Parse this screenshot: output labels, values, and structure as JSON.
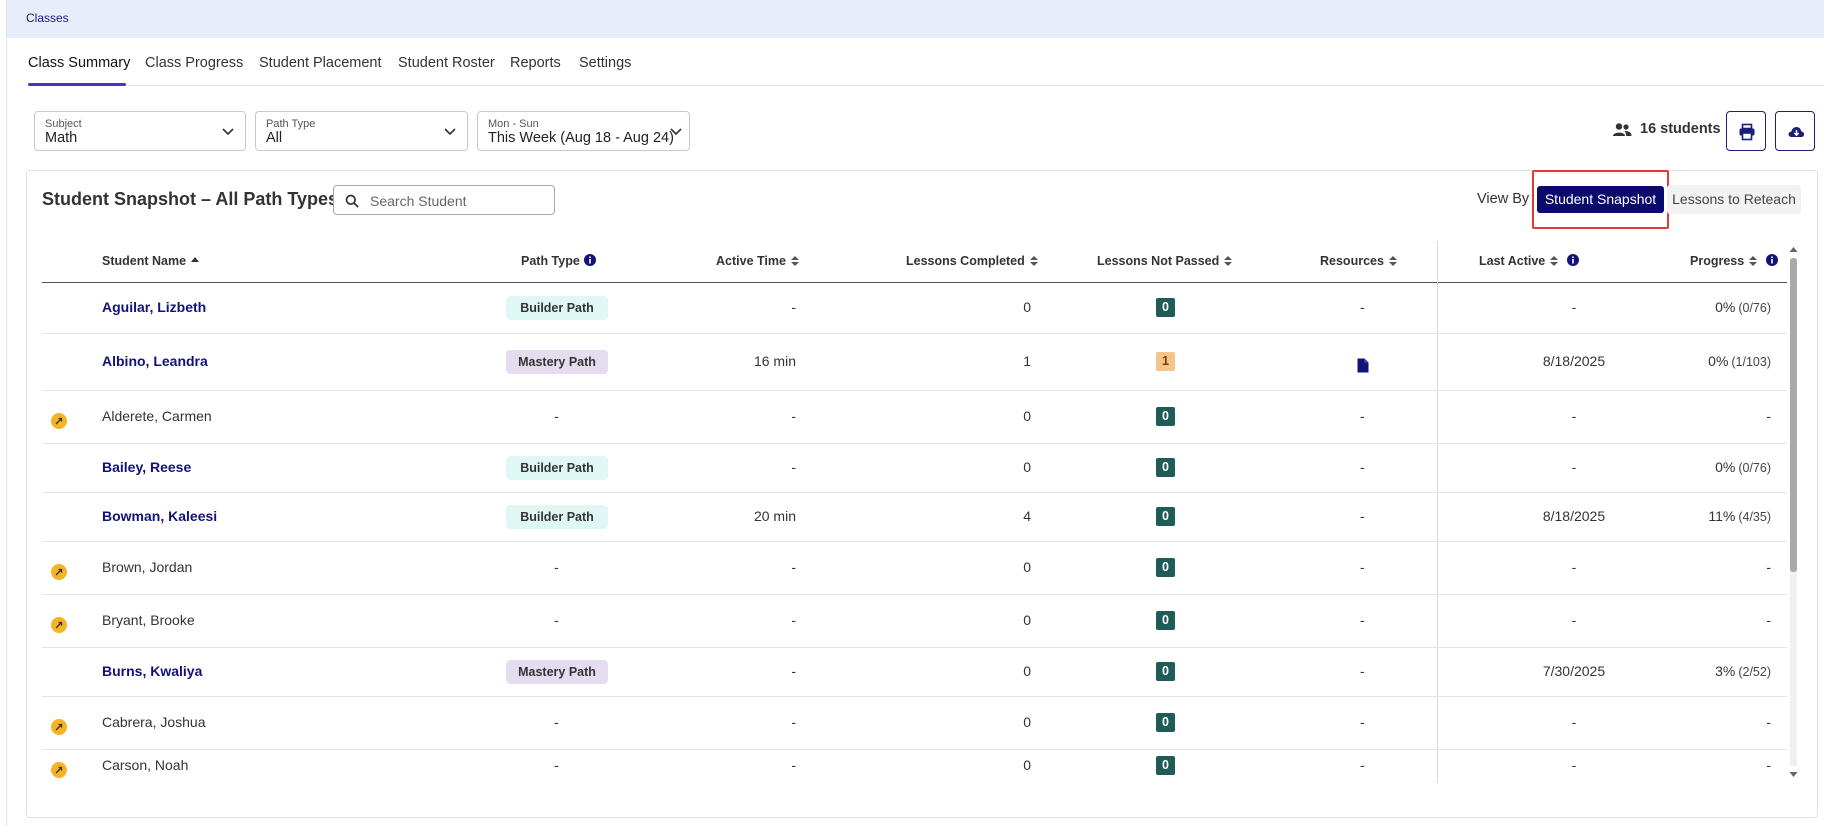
{
  "breadcrumb": "Classes",
  "tabs": [
    "Class Summary",
    "Class Progress",
    "Student Placement",
    "Student Roster",
    "Reports",
    "Settings"
  ],
  "active_tab": "Class Summary",
  "filters": {
    "subject": {
      "label": "Subject",
      "value": "Math"
    },
    "path_type": {
      "label": "Path Type",
      "value": "All"
    },
    "date_range": {
      "label": "Mon - Sun",
      "value": "This Week (Aug 18 - Aug 24)"
    }
  },
  "students_count": "16 students",
  "toolbar": {
    "print_icon": "print-icon",
    "download_icon": "cloud-download-icon"
  },
  "snapshot": {
    "title": "Student Snapshot – All Path Types",
    "search_placeholder": "Search Student",
    "view_by_label": "View By",
    "view_options": [
      "Student Snapshot",
      "Lessons to Reteach"
    ],
    "selected_view": "Student Snapshot"
  },
  "table": {
    "headers": {
      "student_name": "Student Name",
      "path_type": "Path Type",
      "active_time": "Active Time",
      "lessons_completed": "Lessons Completed",
      "lessons_not_passed": "Lessons Not Passed",
      "resources": "Resources",
      "last_active": "Last Active",
      "progress": "Progress"
    },
    "rows": [
      {
        "status_icon": false,
        "name": "Aguilar, Lizbeth",
        "linked": true,
        "path_type": "Builder Path",
        "active_time": "-",
        "lessons_completed": "0",
        "lessons_not_passed": "0",
        "not_passed_warn": false,
        "resources": "-",
        "last_active": "-",
        "progress_pct": "0%",
        "progress_count": "(0/76)"
      },
      {
        "status_icon": false,
        "name": "Albino, Leandra",
        "linked": true,
        "path_type": "Mastery Path",
        "active_time": "16 min",
        "lessons_completed": "1",
        "lessons_not_passed": "1",
        "not_passed_warn": true,
        "resources": "document-icon",
        "last_active": "8/18/2025",
        "progress_pct": "0%",
        "progress_count": "(1/103)"
      },
      {
        "status_icon": true,
        "name": "Alderete, Carmen",
        "linked": false,
        "path_type": "-",
        "active_time": "-",
        "lessons_completed": "0",
        "lessons_not_passed": "0",
        "not_passed_warn": false,
        "resources": "-",
        "last_active": "-",
        "progress_pct": "-",
        "progress_count": ""
      },
      {
        "status_icon": false,
        "name": "Bailey, Reese",
        "linked": true,
        "path_type": "Builder Path",
        "active_time": "-",
        "lessons_completed": "0",
        "lessons_not_passed": "0",
        "not_passed_warn": false,
        "resources": "-",
        "last_active": "-",
        "progress_pct": "0%",
        "progress_count": "(0/76)"
      },
      {
        "status_icon": false,
        "name": "Bowman, Kaleesi",
        "linked": true,
        "path_type": "Builder Path",
        "active_time": "20 min",
        "lessons_completed": "4",
        "lessons_not_passed": "0",
        "not_passed_warn": false,
        "resources": "-",
        "last_active": "8/18/2025",
        "progress_pct": "11%",
        "progress_count": "(4/35)"
      },
      {
        "status_icon": true,
        "name": "Brown, Jordan",
        "linked": false,
        "path_type": "-",
        "active_time": "-",
        "lessons_completed": "0",
        "lessons_not_passed": "0",
        "not_passed_warn": false,
        "resources": "-",
        "last_active": "-",
        "progress_pct": "-",
        "progress_count": ""
      },
      {
        "status_icon": true,
        "name": "Bryant, Brooke",
        "linked": false,
        "path_type": "-",
        "active_time": "-",
        "lessons_completed": "0",
        "lessons_not_passed": "0",
        "not_passed_warn": false,
        "resources": "-",
        "last_active": "-",
        "progress_pct": "-",
        "progress_count": ""
      },
      {
        "status_icon": false,
        "name": "Burns, Kwaliya",
        "linked": true,
        "path_type": "Mastery Path",
        "active_time": "-",
        "lessons_completed": "0",
        "lessons_not_passed": "0",
        "not_passed_warn": false,
        "resources": "-",
        "last_active": "7/30/2025",
        "progress_pct": "3%",
        "progress_count": "(2/52)"
      },
      {
        "status_icon": true,
        "name": "Cabrera, Joshua",
        "linked": false,
        "path_type": "-",
        "active_time": "-",
        "lessons_completed": "0",
        "lessons_not_passed": "0",
        "not_passed_warn": false,
        "resources": "-",
        "last_active": "-",
        "progress_pct": "-",
        "progress_count": ""
      },
      {
        "status_icon": true,
        "name": "Carson, Noah",
        "linked": false,
        "path_type": "-",
        "active_time": "-",
        "lessons_completed": "0",
        "lessons_not_passed": "0",
        "not_passed_warn": false,
        "resources": "-",
        "last_active": "-",
        "progress_pct": "-",
        "progress_count": ""
      }
    ]
  },
  "colors": {
    "accent": "#0b0b6e",
    "tab_underline": "#4338b8",
    "builder_badge": "#dff8f6",
    "mastery_badge": "#e6dcef",
    "not_passed_badge": "#1f5c57",
    "not_passed_warn": "#f5c48b",
    "status_dot": "#f5b325",
    "highlight_box": "#e53935"
  }
}
